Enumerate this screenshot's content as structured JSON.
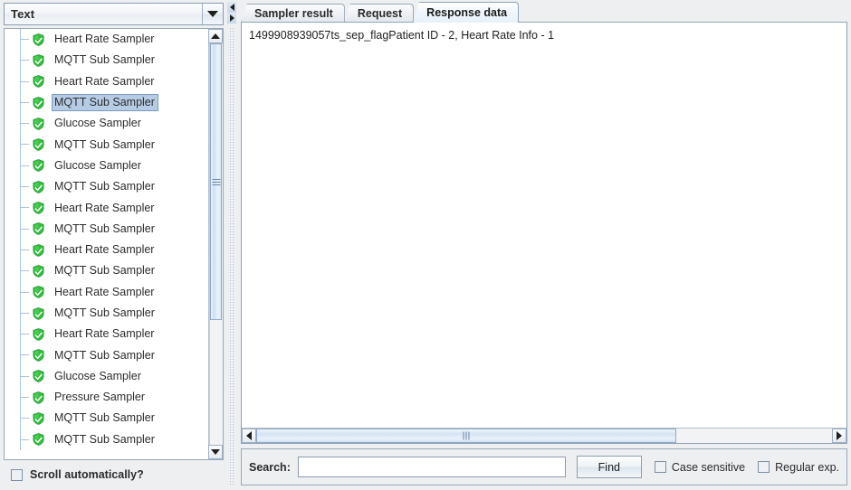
{
  "left_panel": {
    "combo": {
      "selected": "Text",
      "dropdown_icon": "chevron-down-icon"
    },
    "tree_items": [
      {
        "label": "Heart Rate Sampler",
        "icon": "green-shield-check-icon",
        "selected": false
      },
      {
        "label": "MQTT Sub Sampler",
        "icon": "green-shield-check-icon",
        "selected": false
      },
      {
        "label": "Heart Rate Sampler",
        "icon": "green-shield-check-icon",
        "selected": false
      },
      {
        "label": "MQTT Sub Sampler",
        "icon": "green-shield-check-icon",
        "selected": true
      },
      {
        "label": "Glucose Sampler",
        "icon": "green-shield-check-icon",
        "selected": false
      },
      {
        "label": "MQTT Sub Sampler",
        "icon": "green-shield-check-icon",
        "selected": false
      },
      {
        "label": "Glucose Sampler",
        "icon": "green-shield-check-icon",
        "selected": false
      },
      {
        "label": "MQTT Sub Sampler",
        "icon": "green-shield-check-icon",
        "selected": false
      },
      {
        "label": "Heart Rate Sampler",
        "icon": "green-shield-check-icon",
        "selected": false
      },
      {
        "label": "MQTT Sub Sampler",
        "icon": "green-shield-check-icon",
        "selected": false
      },
      {
        "label": "Heart Rate Sampler",
        "icon": "green-shield-check-icon",
        "selected": false
      },
      {
        "label": "MQTT Sub Sampler",
        "icon": "green-shield-check-icon",
        "selected": false
      },
      {
        "label": "Heart Rate Sampler",
        "icon": "green-shield-check-icon",
        "selected": false
      },
      {
        "label": "MQTT Sub Sampler",
        "icon": "green-shield-check-icon",
        "selected": false
      },
      {
        "label": "Heart Rate Sampler",
        "icon": "green-shield-check-icon",
        "selected": false
      },
      {
        "label": "MQTT Sub Sampler",
        "icon": "green-shield-check-icon",
        "selected": false
      },
      {
        "label": "Glucose Sampler",
        "icon": "green-shield-check-icon",
        "selected": false
      },
      {
        "label": "Pressure Sampler",
        "icon": "green-shield-check-icon",
        "selected": false
      },
      {
        "label": "MQTT Sub Sampler",
        "icon": "green-shield-check-icon",
        "selected": false
      },
      {
        "label": "MQTT Sub Sampler",
        "icon": "green-shield-check-icon",
        "selected": false
      }
    ],
    "scroll_auto": {
      "label": "Scroll automatically?",
      "checked": false
    }
  },
  "right_panel": {
    "tabs": [
      {
        "label": "Sampler result",
        "active": false
      },
      {
        "label": "Request",
        "active": false
      },
      {
        "label": "Response data",
        "active": true
      }
    ],
    "response_text": "1499908939057ts_sep_flagPatient ID - 2, Heart Rate Info - 1",
    "search": {
      "label": "Search:",
      "value": "",
      "placeholder": "",
      "find_label": "Find",
      "case_sensitive_label": "Case sensitive",
      "case_sensitive_checked": false,
      "regular_exp_label": "Regular exp.",
      "regular_exp_checked": false
    }
  },
  "colors": {
    "panel_bg": "#edeff1",
    "selection_bg": "#b6cce4",
    "selection_border": "#7a9cc0",
    "shield_green": "#29a329",
    "border": "#9aa8b8",
    "text": "#2b2b2b"
  }
}
